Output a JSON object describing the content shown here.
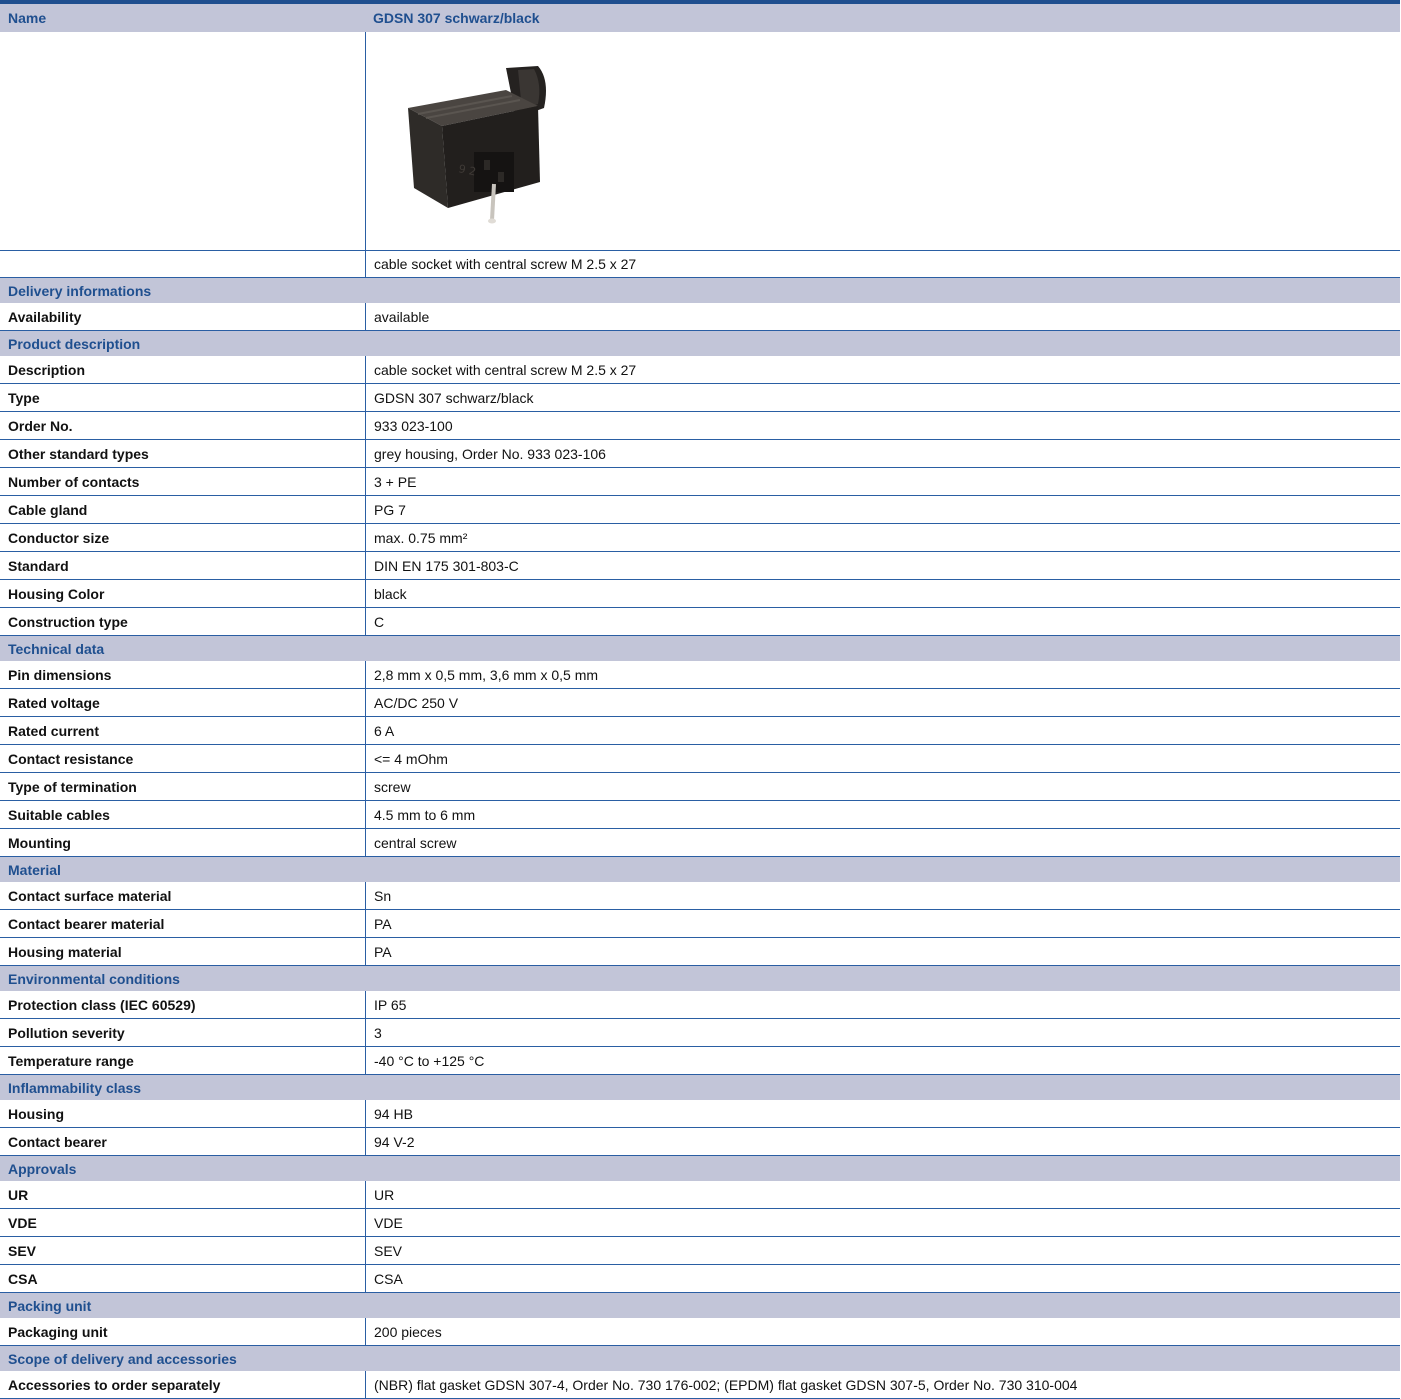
{
  "name_row": {
    "label": "Name",
    "value": "GDSN 307 schwarz/black"
  },
  "image_caption": "cable socket with central screw M 2.5 x 27",
  "product_image": {
    "name": "connector-product-photo",
    "colors": {
      "body": "#2e2b28",
      "shadow": "#1c1a18"
    }
  },
  "sections": [
    {
      "header": "Delivery informations",
      "rows": [
        {
          "label": "Availability",
          "value": "available"
        }
      ]
    },
    {
      "header": "Product description",
      "rows": [
        {
          "label": "Description",
          "value": "cable socket with central screw M 2.5 x 27"
        },
        {
          "label": "Type",
          "value": "GDSN 307 schwarz/black"
        },
        {
          "label": "Order No.",
          "value": "933 023-100"
        },
        {
          "label": "Other standard types",
          "value": "grey housing, Order No. 933 023-106"
        },
        {
          "label": "Number of contacts",
          "value": "3 + PE"
        },
        {
          "label": "Cable gland",
          "value": "PG 7"
        },
        {
          "label": "Conductor size",
          "value": "max. 0.75 mm²"
        },
        {
          "label": "Standard",
          "value": "DIN EN 175 301-803-C"
        },
        {
          "label": "Housing Color",
          "value": "black"
        },
        {
          "label": "Construction type",
          "value": "C"
        }
      ]
    },
    {
      "header": "Technical data",
      "rows": [
        {
          "label": "Pin dimensions",
          "value": "2,8 mm x 0,5 mm, 3,6 mm x 0,5 mm"
        },
        {
          "label": "Rated voltage",
          "value": "AC/DC 250 V"
        },
        {
          "label": "Rated current",
          "value": "6 A"
        },
        {
          "label": "Contact resistance",
          "value": "<= 4 mOhm"
        },
        {
          "label": "Type of termination",
          "value": "screw"
        },
        {
          "label": "Suitable cables",
          "value": "4.5 mm to 6 mm"
        },
        {
          "label": "Mounting",
          "value": "central screw"
        }
      ]
    },
    {
      "header": "Material",
      "rows": [
        {
          "label": "Contact surface material",
          "value": "Sn"
        },
        {
          "label": "Contact bearer material",
          "value": "PA"
        },
        {
          "label": "Housing material",
          "value": "PA"
        }
      ]
    },
    {
      "header": "Environmental conditions",
      "rows": [
        {
          "label": "Protection class (IEC 60529)",
          "value": "IP 65"
        },
        {
          "label": "Pollution severity",
          "value": "3"
        },
        {
          "label": "Temperature range",
          "value": "-40 °C to +125 °C"
        }
      ]
    },
    {
      "header": "Inflammability class",
      "rows": [
        {
          "label": "Housing",
          "value": "94 HB"
        },
        {
          "label": "Contact bearer",
          "value": "94 V-2"
        }
      ]
    },
    {
      "header": "Approvals",
      "rows": [
        {
          "label": "UR",
          "value": "UR"
        },
        {
          "label": "VDE",
          "value": "VDE"
        },
        {
          "label": "SEV",
          "value": "SEV"
        },
        {
          "label": "CSA",
          "value": "CSA"
        }
      ]
    },
    {
      "header": "Packing unit",
      "rows": [
        {
          "label": "Packaging unit",
          "value": "200 pieces"
        }
      ]
    },
    {
      "header": "Scope of delivery and accessories",
      "rows": [
        {
          "label": "Accessories to order separately",
          "value": "(NBR) flat gasket GDSN 307-4, Order No. 730 176-002; (EPDM) flat gasket GDSN 307-5, Order No. 730 310-004"
        }
      ]
    }
  ]
}
